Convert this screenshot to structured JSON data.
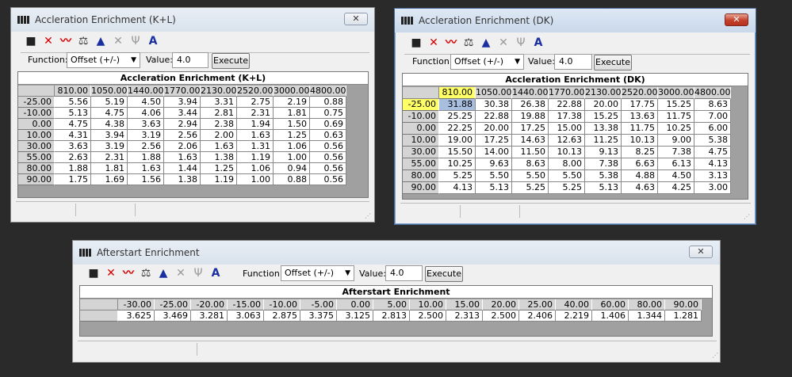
{
  "toolbar_icons": [
    {
      "name": "save-icon",
      "glyph": "■"
    },
    {
      "name": "delete-icon",
      "glyph": "✕"
    },
    {
      "name": "graph-icon",
      "glyph": "〰"
    },
    {
      "name": "balance-icon",
      "glyph": "⚖"
    },
    {
      "name": "triangle-scale-icon",
      "glyph": "▲"
    },
    {
      "name": "disabled-x-icon",
      "glyph": "✕"
    },
    {
      "name": "interpolate-icon",
      "glyph": "Ψ"
    },
    {
      "name": "font-icon",
      "glyph": "A"
    }
  ],
  "function_label": "Function:",
  "value_label": "Value:",
  "windows": [
    {
      "title": "Accleration Enrichment (K+L)",
      "close": "✕",
      "function_value": "Offset (+/-)",
      "value": "4.0",
      "execute": "Execute",
      "table_title": "Accleration Enrichment (K+L)",
      "columns": [
        "810.00",
        "1050.00",
        "1440.00",
        "1770.00",
        "2130.00",
        "2520.00",
        "3000.00",
        "4800.00"
      ],
      "rows": [
        {
          "label": "-25.00",
          "values": [
            "5.56",
            "5.19",
            "4.50",
            "3.94",
            "3.31",
            "2.75",
            "2.19",
            "0.88"
          ]
        },
        {
          "label": "-10.00",
          "values": [
            "5.13",
            "4.75",
            "4.06",
            "3.44",
            "2.81",
            "2.31",
            "1.81",
            "0.75"
          ]
        },
        {
          "label": "0.00",
          "values": [
            "4.75",
            "4.38",
            "3.63",
            "2.94",
            "2.38",
            "1.94",
            "1.50",
            "0.69"
          ]
        },
        {
          "label": "10.00",
          "values": [
            "4.31",
            "3.94",
            "3.19",
            "2.56",
            "2.00",
            "1.63",
            "1.25",
            "0.63"
          ]
        },
        {
          "label": "30.00",
          "values": [
            "3.63",
            "3.19",
            "2.56",
            "2.06",
            "1.63",
            "1.31",
            "1.06",
            "0.56"
          ]
        },
        {
          "label": "55.00",
          "values": [
            "2.63",
            "2.31",
            "1.88",
            "1.63",
            "1.38",
            "1.19",
            "1.00",
            "0.56"
          ]
        },
        {
          "label": "80.00",
          "values": [
            "1.88",
            "1.81",
            "1.63",
            "1.44",
            "1.25",
            "1.06",
            "0.94",
            "0.56"
          ]
        },
        {
          "label": "90.00",
          "values": [
            "1.75",
            "1.69",
            "1.56",
            "1.38",
            "1.19",
            "1.00",
            "0.88",
            "0.56"
          ]
        }
      ]
    },
    {
      "title": "Accleration Enrichment (DK)",
      "close": "✕",
      "function_value": "Offset (+/-)",
      "value": "4.0",
      "execute": "Execute",
      "table_title": "Accleration Enrichment (DK)",
      "columns": [
        "810.00",
        "1050.00",
        "1440.00",
        "1770.00",
        "2130.00",
        "2520.00",
        "3000.00",
        "4800.00"
      ],
      "rows": [
        {
          "label": "-25.00",
          "values": [
            "31.88",
            "30.38",
            "26.38",
            "22.88",
            "20.00",
            "17.75",
            "15.25",
            "8.63"
          ]
        },
        {
          "label": "-10.00",
          "values": [
            "25.25",
            "22.88",
            "19.88",
            "17.38",
            "15.25",
            "13.63",
            "11.75",
            "7.00"
          ]
        },
        {
          "label": "0.00",
          "values": [
            "22.25",
            "20.00",
            "17.25",
            "15.00",
            "13.38",
            "11.75",
            "10.25",
            "6.00"
          ]
        },
        {
          "label": "10.00",
          "values": [
            "19.00",
            "17.25",
            "14.63",
            "12.63",
            "11.25",
            "10.13",
            "9.00",
            "5.38"
          ]
        },
        {
          "label": "30.00",
          "values": [
            "15.50",
            "14.00",
            "11.50",
            "10.13",
            "9.13",
            "8.25",
            "7.38",
            "4.75"
          ]
        },
        {
          "label": "55.00",
          "values": [
            "10.25",
            "9.63",
            "8.63",
            "8.00",
            "7.38",
            "6.63",
            "6.13",
            "4.13"
          ]
        },
        {
          "label": "80.00",
          "values": [
            "5.25",
            "5.50",
            "5.50",
            "5.50",
            "5.38",
            "4.88",
            "4.50",
            "3.13"
          ]
        },
        {
          "label": "90.00",
          "values": [
            "4.13",
            "5.13",
            "5.25",
            "5.25",
            "5.13",
            "4.63",
            "4.25",
            "3.00"
          ]
        }
      ]
    },
    {
      "title": "Afterstart Enrichment",
      "close": "✕",
      "function_value": "Offset (+/-)",
      "value": "4.0",
      "execute": "Execute",
      "table_title": "Afterstart Enrichment",
      "columns": [
        "-30.00",
        "-25.00",
        "-20.00",
        "-15.00",
        "-10.00",
        "-5.00",
        "0.00",
        "5.00",
        "10.00",
        "15.00",
        "20.00",
        "25.00",
        "40.00",
        "60.00",
        "80.00",
        "90.00"
      ],
      "rows": [
        {
          "label": "",
          "values": [
            "3.625",
            "3.469",
            "3.281",
            "3.063",
            "2.875",
            "3.375",
            "3.125",
            "2.813",
            "2.500",
            "2.313",
            "2.500",
            "2.406",
            "2.219",
            "1.406",
            "1.344",
            "1.281"
          ]
        }
      ]
    }
  ],
  "colors": {
    "active_close": "#c4402a",
    "highlight": "#ffff66",
    "selected_cell": "#a8bedf",
    "table_bg": "#a0a0a0"
  }
}
